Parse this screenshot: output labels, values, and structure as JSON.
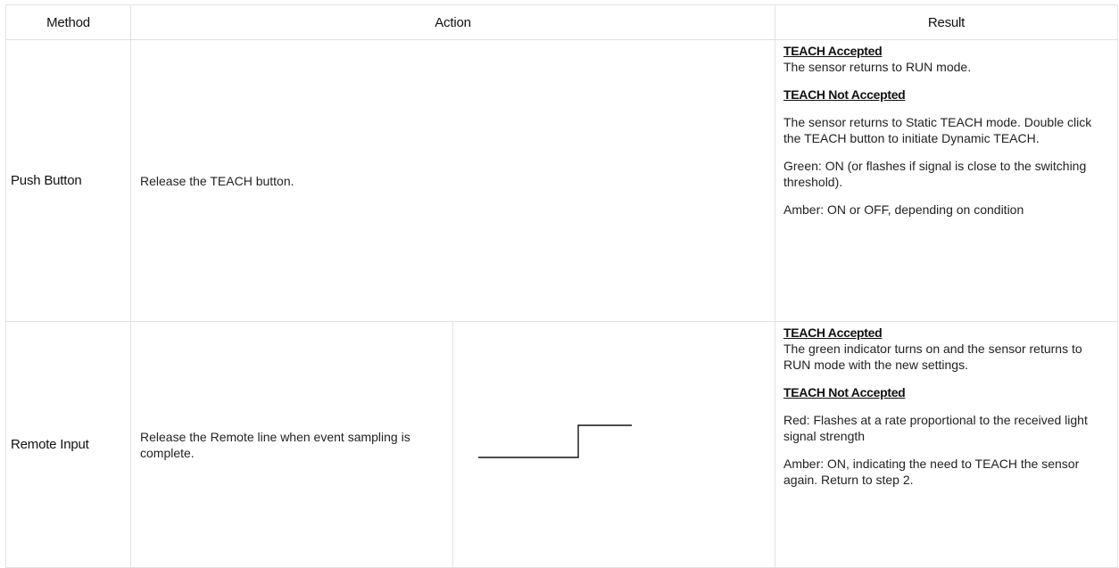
{
  "table": {
    "headers": {
      "method": "Method",
      "action": "Action",
      "result": "Result"
    },
    "rows": [
      {
        "method": "Push Button",
        "action": "Release the TEACH button.",
        "result": {
          "accepted_heading": "TEACH Accepted",
          "accepted_text": "The sensor returns to RUN mode.",
          "not_accepted_heading": "TEACH Not Accepted",
          "not_accepted_paragraphs": [
            "The sensor returns to Static TEACH mode. Double click the TEACH button to initiate Dynamic TEACH.",
            "Green: ON (or flashes if signal is close to the switching threshold).",
            "Amber: ON or OFF, depending on condition"
          ]
        }
      },
      {
        "method": "Remote Input",
        "action": "Release the Remote line when event sampling is complete.",
        "result": {
          "accepted_heading": "TEACH Accepted",
          "accepted_text": "The green indicator turns on and the sensor returns to RUN mode with the new settings.",
          "not_accepted_heading": "TEACH Not Accepted",
          "not_accepted_paragraphs": [
            "Red: Flashes at a rate proportional to the received light signal strength",
            "Amber: ON, indicating the need to TEACH the sensor again. Return to step 2."
          ]
        }
      }
    ]
  }
}
